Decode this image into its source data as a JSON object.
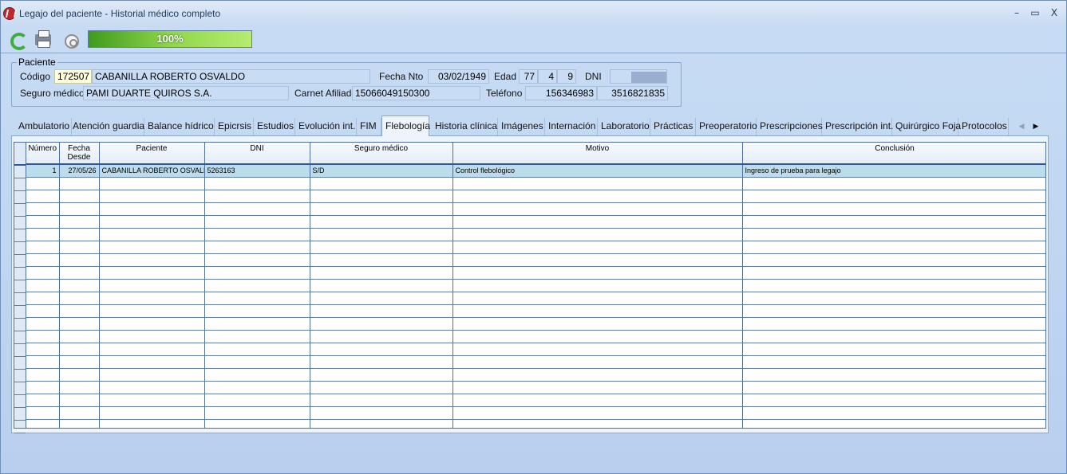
{
  "window": {
    "title": "Legajo del paciente - Historial médico completo",
    "minimize": "–",
    "maximize": "▭",
    "close": "X"
  },
  "toolbar": {
    "progress_label": "100%",
    "progress_value": 1.0
  },
  "patient": {
    "legend": "Paciente",
    "codigo_label": "Código",
    "codigo": "172507",
    "nombre": "CABANILLA ROBERTO OSVALDO",
    "fecha_nto_label": "Fecha Nto",
    "fecha_nto": "03/02/1949",
    "edad_label": "Edad",
    "edad_years": "77",
    "edad_months": "4",
    "edad_days": "9",
    "dni_label": "DNI",
    "seguro_label": "Seguro médico",
    "seguro": "PAMI DUARTE QUIROS S.A.",
    "carnet_label": "Carnet Afiliado",
    "carnet": "15066049150300",
    "telefono_label": "Teléfono",
    "telefono1": "156346983",
    "telefono2": "3516821835"
  },
  "tabs": [
    "Ambulatorio",
    "Atención guardia",
    "Balance hídrico",
    "Epicrsis",
    "Estudios",
    "Evolución int.",
    "FIM",
    "Flebología",
    "Historia clínica",
    "Imágenes",
    "Internación",
    "Laboratorio",
    "Prácticas",
    "Preoperatorio",
    "Prescripciones",
    "Prescripción int.",
    "Quirúrgico Foja",
    "Protocolos"
  ],
  "active_tab": "Flebología",
  "grid": {
    "columns": [
      "Número",
      "Fecha\nDesde",
      "Paciente",
      "DNI",
      "Seguro médico",
      "Motivo",
      "Conclusión"
    ],
    "rows": [
      [
        "1",
        "27/05/26",
        "CABANILLA ROBERTO OSVALDO",
        "5263163",
        "S/D",
        "Control flebológico",
        "Ingreso de prueba para legajo"
      ]
    ]
  }
}
